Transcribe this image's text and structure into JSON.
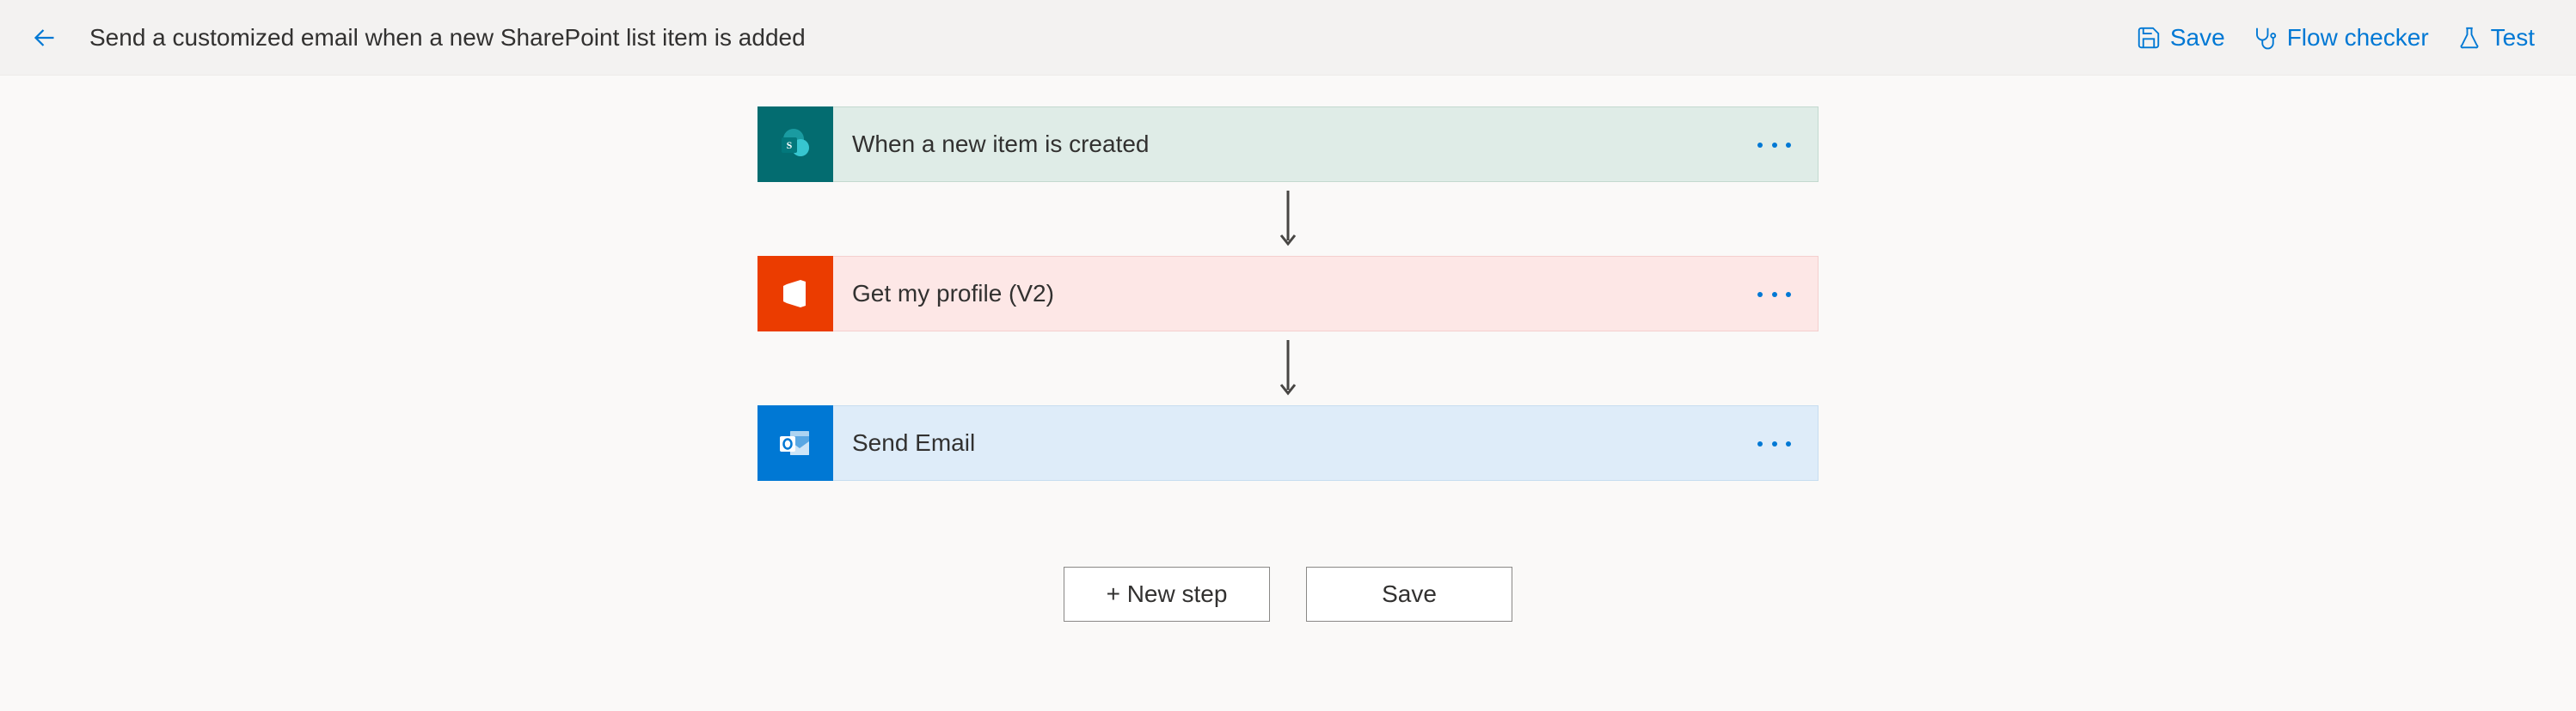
{
  "header": {
    "title": "Send a customized email when a new SharePoint list item is added",
    "actions": {
      "save": "Save",
      "flow_checker": "Flow checker",
      "test": "Test"
    }
  },
  "steps": [
    {
      "label": "When a new item is created",
      "connector": "sharepoint"
    },
    {
      "label": "Get my profile (V2)",
      "connector": "office"
    },
    {
      "label": "Send Email",
      "connector": "outlook"
    }
  ],
  "footer": {
    "new_step": "+ New step",
    "save": "Save"
  }
}
